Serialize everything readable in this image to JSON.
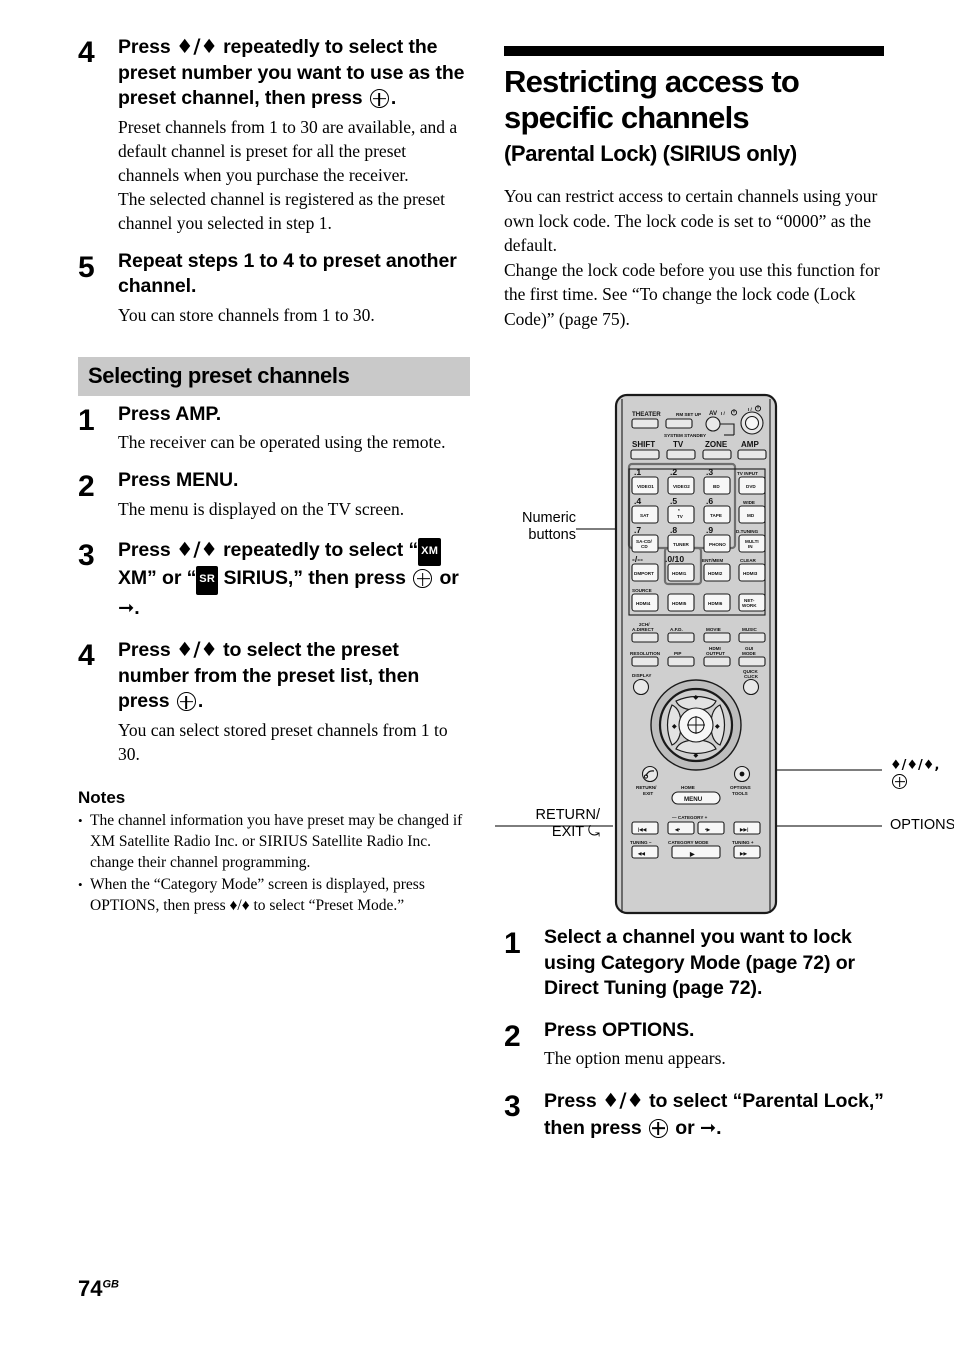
{
  "page": {
    "number": "74",
    "region": "GB"
  },
  "left_column": {
    "steps": [
      {
        "num": "4",
        "title_pre": "Press ",
        "title_arrows": "♦/♦",
        "title_mid": " repeatedly to select the preset number you want to use as the preset channel, then press ",
        "title_post": ".",
        "desc": [
          "Preset channels from 1 to 30 are available, and a default channel is preset for all the preset channels when you purchase the receiver.",
          "The selected channel is registered as the preset channel you selected in step 1."
        ]
      },
      {
        "num": "5",
        "title": "Repeat steps 1 to 4 to preset another channel.",
        "desc": [
          "You can store channels from 1 to 30."
        ]
      }
    ],
    "section_header": "Selecting preset channels",
    "section_steps": [
      {
        "num": "1",
        "title": "Press AMP.",
        "desc": [
          "The receiver can be operated using the remote."
        ]
      },
      {
        "num": "2",
        "title": "Press MENU.",
        "desc": [
          "The menu is displayed on the TV screen."
        ]
      },
      {
        "num": "3",
        "title_a": "Press ",
        "arrows": "♦/♦",
        "title_b": " repeatedly to select “",
        "badge1": "XM",
        "title_c": " XM” or “",
        "badge2": "SR",
        "title_d": " SIRIUS,” then press ",
        "title_e": " or ",
        "title_f": "."
      },
      {
        "num": "4",
        "title_a": "Press ",
        "arrows": "♦/♦",
        "title_b": " to select the preset number from the preset list, then press ",
        "title_c": ".",
        "desc": [
          "You can select stored preset channels from 1 to 30."
        ]
      }
    ],
    "notes_title": "Notes",
    "notes": [
      "The channel information you have preset may be changed if XM Satellite Radio Inc. or SIRIUS Satellite Radio Inc. change their channel programming.",
      "When the “Category Mode” screen is displayed, press OPTIONS, then press ♦/♦ to select “Preset Mode.”"
    ]
  },
  "right_column": {
    "chapter_title": "Restricting access to specific channels",
    "chapter_subtitle": "(Parental Lock) (SIRIUS only)",
    "intro": [
      "You can restrict access to certain channels using your own lock code. The lock code is set to “0000” as the default.",
      "Change the lock code before you use this function for the first time. See “To change the lock code (Lock Code)” (page 75)."
    ],
    "steps": [
      {
        "num": "1",
        "title": "Select a channel you want to lock using Category Mode (page 72) or Direct Tuning (page 72)."
      },
      {
        "num": "2",
        "title": "Press OPTIONS.",
        "desc": [
          "The option menu appears."
        ]
      },
      {
        "num": "3",
        "title_a": "Press ",
        "arrows": "♦/♦",
        "title_b": " to select “Parental Lock,” then press ",
        "title_c": " or ",
        "title_d": "."
      }
    ]
  },
  "figure": {
    "callouts": {
      "numeric_buttons_l1": "Numeric",
      "numeric_buttons_l2": "buttons",
      "return_exit_l1": "RETURN/",
      "return_exit_l2": "EXIT",
      "nav_arrows": "♦/♦/♦,",
      "options": "OPTIONS"
    },
    "remote": {
      "row_top_labels": [
        "THEATER",
        "RM SET UP",
        "AV",
        "SYSTEM STANDBY"
      ],
      "power_av_label": "AV I / ⏻",
      "power_main_label": "I / ⏻",
      "system_standby": "SYSTEM STANDBY",
      "row_mode": [
        "SHIFT",
        "TV",
        "ZONE",
        "AMP"
      ],
      "numeric_rows": [
        {
          "nums": [
            ".1",
            ".2",
            ".3"
          ],
          "keys": [
            "VIDEO1",
            "VIDEO2",
            "BD"
          ],
          "right_label": "TV INPUT",
          "right_key": "DVD"
        },
        {
          "nums": [
            ".4",
            ".5",
            ".6"
          ],
          "keys": [
            "SAT",
            "TV",
            "TAPE"
          ],
          "right_label": "WIDE",
          "right_key": "MD"
        },
        {
          "nums": [
            ".7",
            ".8",
            ".9"
          ],
          "keys": [
            "SA-CD/\nCD",
            "TUNER",
            "PHONO"
          ],
          "right_label": "D.TUNING",
          "right_key": "MULTI\nIN"
        },
        {
          "nums": [
            "-/--",
            ".0/10",
            "ENT/MEM"
          ],
          "keys": [
            "DMPORT",
            "HDMI1",
            "HDMI2"
          ],
          "right_label": "CLEAR",
          "right_key": "HDMI3"
        }
      ],
      "source_label": "SOURCE",
      "source_keys": [
        "HDMI4",
        "HDMI5",
        "HDMI6",
        "NET-\nWORK"
      ],
      "sound_labels": [
        "2CH/\nA.DIRECT",
        "A.F.D.",
        "MOVIE",
        "MUSIC"
      ],
      "video_labels": [
        "RESOLUTION",
        "PIP",
        "HDMI\nOUTPUT",
        "GUI\nMODE"
      ],
      "display_label": "DISPLAY",
      "quick_click_label": "QUICK\nCLICK",
      "home_label": "HOME",
      "menu_label": "MENU",
      "return_label": "RETURN/\nEXIT",
      "options_label": "OPTIONS\nTOOLS",
      "category_label": "— CATEGORY +",
      "tuning_minus": "TUNING −",
      "tuning_plus": "TUNING +",
      "category_mode": "CATEGORY MODE"
    }
  }
}
